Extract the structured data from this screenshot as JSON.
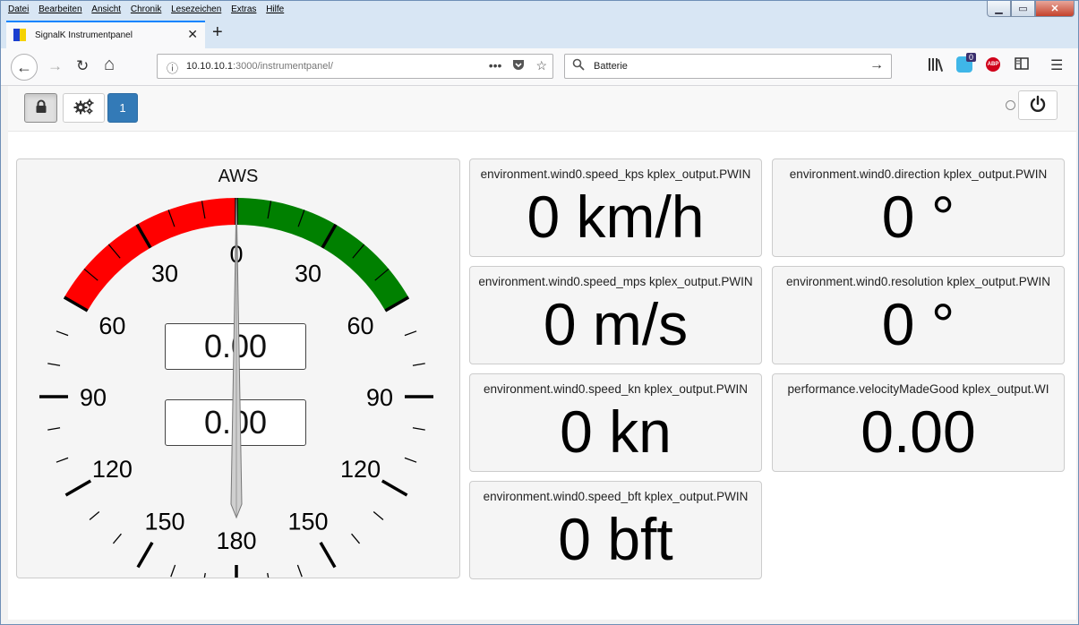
{
  "menu": [
    "Datei",
    "Bearbeiten",
    "Ansicht",
    "Chronik",
    "Lesezeichen",
    "Extras",
    "Hilfe"
  ],
  "window_controls": {
    "minimize": "▁",
    "maximize": "▭",
    "close": "✕"
  },
  "tab": {
    "title": "SignalK Instrumentpanel",
    "close": "✕",
    "new_tab": "+"
  },
  "nav": {
    "back_icon": "←",
    "forward_icon": "→",
    "reload_icon": "↻",
    "home_icon": "⌂",
    "url_host": "10.10.10.1",
    "url_rest": ":3000/instrumentpanel/",
    "info_icon": "ⓘ",
    "search_text": "Batterie",
    "ext_badge": "0",
    "abp_label": "ABP"
  },
  "app_toolbar": {
    "lock_icon": "lock-icon",
    "settings_icon": "gears-icon",
    "page_number": "1",
    "power_icon": "power-icon"
  },
  "gauge": {
    "title": "AWS",
    "value_top": "0.00",
    "value_bottom": "0.00",
    "needle_angle": 0,
    "tick_labels": [
      "0",
      "30",
      "60",
      "90",
      "120",
      "150",
      "180"
    ],
    "red_zone_color": "#ff0000",
    "green_zone_color": "#008000"
  },
  "panels": [
    {
      "label": "environment.wind0.speed_kps kplex_output.PWIN",
      "value": "0 km/h"
    },
    {
      "label": "environment.wind0.direction kplex_output.PWIN",
      "value": "0 °"
    },
    {
      "label": "environment.wind0.speed_mps kplex_output.PWIN",
      "value": "0 m/s"
    },
    {
      "label": "environment.wind0.resolution kplex_output.PWIN",
      "value": "0 °"
    },
    {
      "label": "environment.wind0.speed_kn kplex_output.PWIN",
      "value": "0 kn"
    },
    {
      "label": "performance.velocityMadeGood kplex_output.WI",
      "value": "0.00"
    },
    {
      "label": "environment.wind0.speed_bft kplex_output.PWIN",
      "value": "0 bft"
    }
  ]
}
